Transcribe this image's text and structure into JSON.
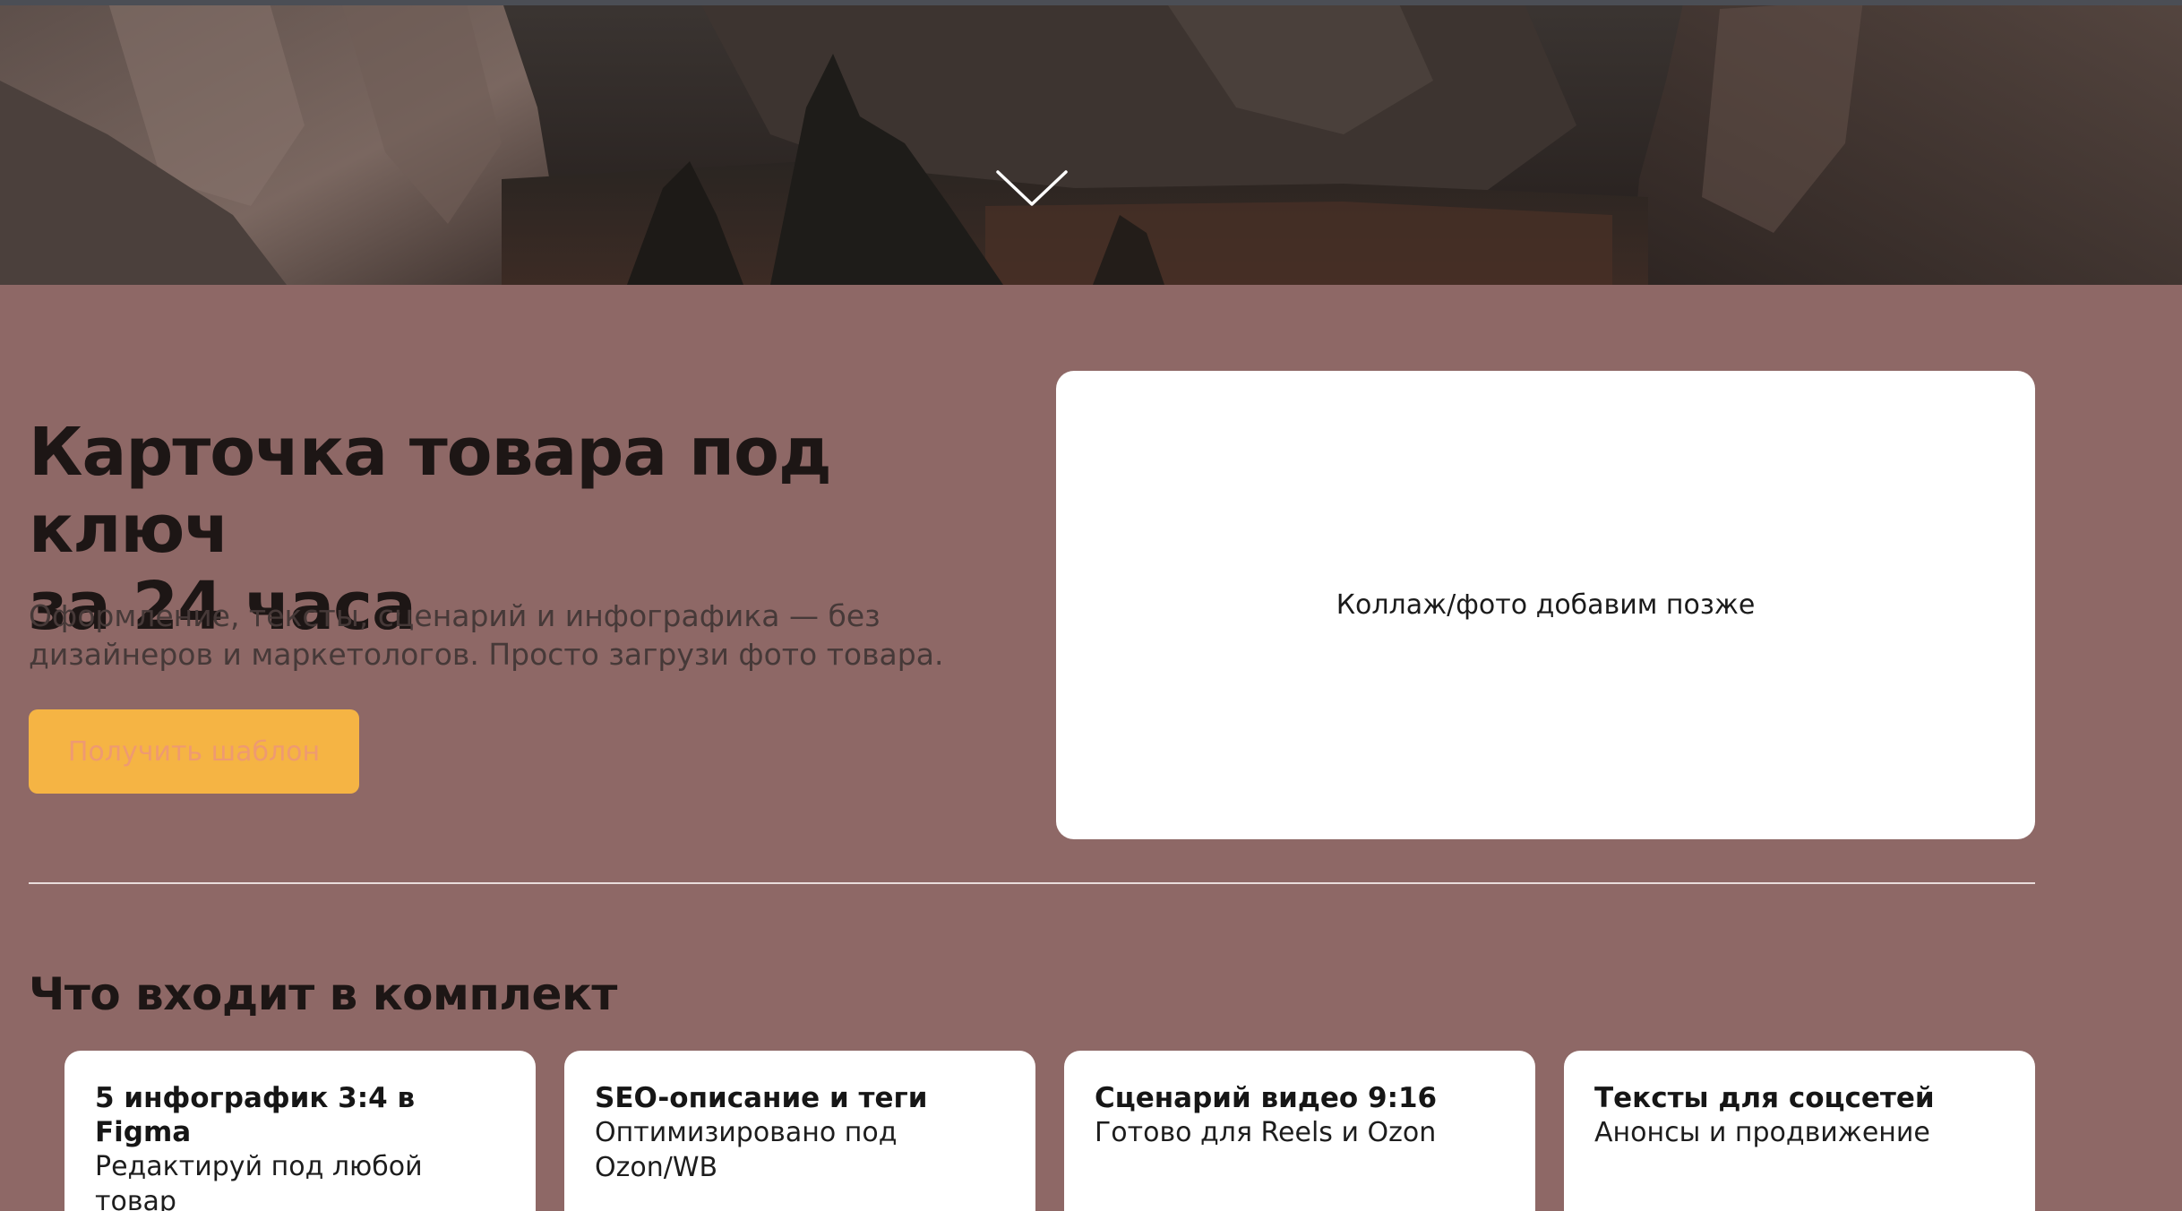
{
  "hero": {
    "headline_line1": "Карточка товара под ключ",
    "headline_line2": "за 24 часа",
    "subtitle_line1": "Оформление, тексты, сценарий и инфографика — без",
    "subtitle_line2": "дизайнеров и маркетологов. Просто загрузи фото товара.",
    "cta_label": "Получить шаблон"
  },
  "placeholder": {
    "text": "Коллаж/фото добавим позже"
  },
  "package": {
    "title": "Что входит в комплект",
    "items": [
      {
        "title": "5 инфографик 3:4 в Figma",
        "desc": "Редактируй под любой товар"
      },
      {
        "title": "SEO-описание и теги",
        "desc": "Оптимизировано под Ozon/WB"
      },
      {
        "title": "Сценарий видео 9:16",
        "desc": "Готово для Reels и Ozon"
      },
      {
        "title": "Тексты для соцсетей",
        "desc": "Анонсы и продвижение"
      }
    ]
  },
  "colors": {
    "page_background": "#8e6866",
    "cta_background": "#f5b444",
    "cta_text": "#ee9a71",
    "card_background": "#ffffff"
  },
  "icons": {
    "scroll_down": "chevron-down-icon"
  }
}
